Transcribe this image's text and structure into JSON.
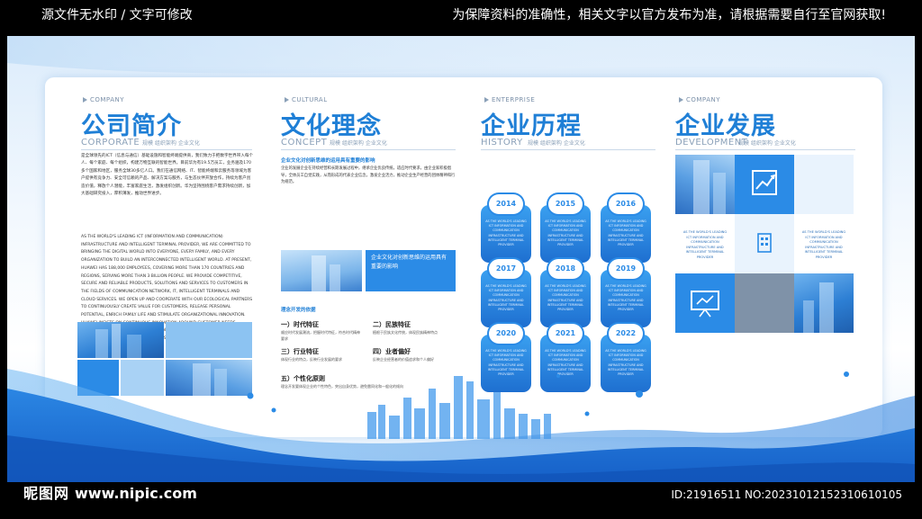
{
  "topbar": {
    "left_note": "源文件无水印 / 文字可修改",
    "right_note": "为保障资料的准确性，相关文字以官方发布为准，请根据需要自行至官网获取!"
  },
  "sections": {
    "company": {
      "en_tag": "COMPANY",
      "title": "公司简介",
      "subtitle": "CORPORATE",
      "tags": "规模 组织架构 企业文化",
      "body_cn": "是全球领先的ICT（信息与通信）基础设施和智能终端提供商，我们致力于把数字世界带入每个人、每个家庭、每个组织，构建万物互联的智能世界。目前华为有19.5万员工，业务遍及170多个国家和地区，服务全球30多亿人口。我们在通信网络、IT、智能终端和云服务等领域为客户提供有竞争力、安全可信赖的产品、解决方案与服务，与生态伙伴开放合作，持续为客户创造价值，释放个人潜能，丰富家庭生活，激发组织创新。华为坚持围绕客户需求持续创新，加大基础研究投入，厚积薄发，推动世界进步。",
      "body_en": "As the world's leading ICT (information and communication) infrastructure and intelligent terminal provider, we are committed to bringing the digital world into everyone, every family, and every organization to build an interconnected intelligent world. At present, Huawei has 188,000 employees, covering more than 170 countries and regions, serving more than 3 billion people. We provide competitive, secure and reliable products, solutions and services to customers in the fields of communication network, IT, intelligent terminals and cloud services. We open up and cooperate with our ecological partners to continuously create value for customers, release personal potential, enrich family life and stimulate organizational innovation. Huawei insists on continuous innovation around customer needs, increases investment in basic research, accumulates rich and develops thin, and promotes world progress."
    },
    "culture": {
      "en_tag": "CULTURAL",
      "title": "文化理念",
      "subtitle": "CONCEPT",
      "tags": "规模 组织架构 企业文化",
      "headline": "企业文化对创新思维的运用具有重要的影响",
      "intro": "企业的发展企业在持续经营和长期发展过程中，继承企业优良传统，适应时代要求，由企业家积极倡导，全体员工自觉实践，从而形成的代表企业信念，激发企业活力，推动企业生产经营的团体精神和行为规范。",
      "box_text": "企业文化对创新思维的运用具有重要的影响",
      "principles_heading": "理念开发的依据",
      "items": [
        {
          "title": "一）时代特征",
          "text": "顺应时代发展潮流，把握时代特征，符合时代精神要求"
        },
        {
          "title": "二）民族特征",
          "text": "植根于民族文化传统，体现民族精神特点"
        },
        {
          "title": "三）行业特征",
          "text": "体现行业的特点，反映行业发展的要求"
        },
        {
          "title": "四）业者偏好",
          "text": "反映企业经营者的价值追求和个人偏好"
        },
        {
          "title": "五）个性化原则",
          "text": "理念开发要体现企业的个性特色，突出自身优势，避免雷同化和一般化的倾向"
        }
      ]
    },
    "history": {
      "en_tag": "ENTERPRISE",
      "title": "企业历程",
      "subtitle": "HISTORY",
      "tags": "规模 组织架构 企业文化",
      "cards": [
        {
          "year": "2014",
          "text": "As the world's leading ICT information and communication infrastructure and intelligent terminal provider"
        },
        {
          "year": "2015",
          "text": "As the world's leading ICT information and communication infrastructure and intelligent terminal provider"
        },
        {
          "year": "2016",
          "text": "As the world's leading ICT information and communication infrastructure and intelligent terminal provider"
        },
        {
          "year": "2017",
          "text": "As the world's leading ICT information and communication infrastructure and intelligent terminal provider"
        },
        {
          "year": "2018",
          "text": "As the world's leading ICT information and communication infrastructure and intelligent terminal provider"
        },
        {
          "year": "2019",
          "text": "As the world's leading ICT information and communication infrastructure and intelligent terminal provider"
        },
        {
          "year": "2020",
          "text": "As the world's leading ICT information and communication infrastructure and intelligent terminal provider"
        },
        {
          "year": "2021",
          "text": "As the world's leading ICT information and communication infrastructure and intelligent terminal provider"
        },
        {
          "year": "2022",
          "text": "As the world's leading ICT information and communication infrastructure and intelligent terminal provider"
        }
      ]
    },
    "development": {
      "en_tag": "COMPANY",
      "title": "企业发展",
      "subtitle": "DEVELOPMENT",
      "tags": "规模 组织架构 企业文化",
      "cell_text_1": "As the world's leading ICT information and communication infrastructure and intelligent terminal provider",
      "cell_text_2": "As the world's leading ICT information and communication infrastructure and intelligent terminal provider"
    }
  },
  "watermark": {
    "site_name": "昵图网",
    "site_url": "www.nipic.com",
    "id_line": "ID:21916511 NO:20231012152310610105"
  },
  "colors": {
    "accent": "#1f7fd6",
    "card_blue": "#2b8be6",
    "wave_blue": "#1c6fd8"
  }
}
